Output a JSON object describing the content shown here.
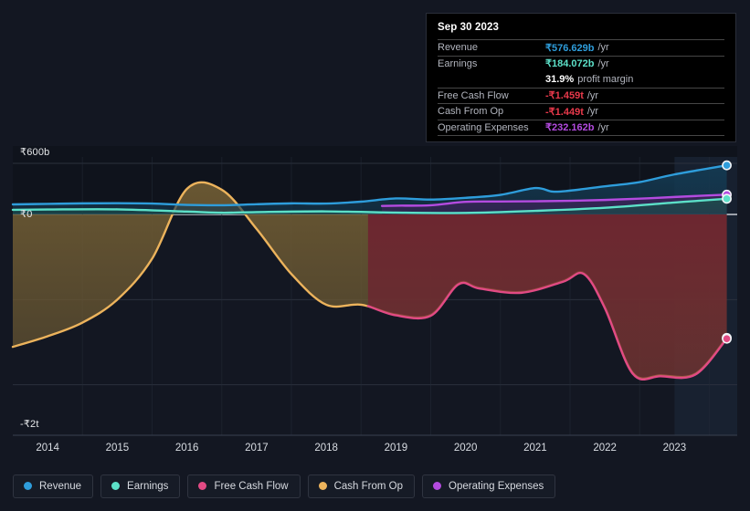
{
  "chart_data": {
    "type": "area",
    "title": "",
    "xlabel": "",
    "ylabel": "",
    "currency": "INR",
    "grid": true,
    "legend_position": "bottom",
    "x_ticks": [
      "2014",
      "2015",
      "2016",
      "2017",
      "2018",
      "2019",
      "2020",
      "2021",
      "2022",
      "2023"
    ],
    "y_ticks": [
      "₹600b",
      "₹0",
      "-₹2t"
    ],
    "y_tick_values": [
      600000000000,
      0,
      -2000000000000
    ],
    "ylim": [
      -2200000000000,
      760000000000
    ],
    "xlim": [
      "2013.5",
      "2023.9"
    ],
    "gridlines_y": [
      600000000000,
      0,
      -1000000000000,
      -2000000000000
    ],
    "series": [
      {
        "name": "Revenue",
        "color": "#2e9ddb",
        "fill": "#143a52",
        "x": [
          2013.5,
          2014,
          2014.5,
          2015,
          2015.5,
          2016,
          2016.5,
          2017,
          2017.5,
          2018,
          2018.5,
          2019,
          2019.5,
          2020,
          2020.5,
          2021,
          2021.25,
          2021.5,
          2022,
          2022.5,
          2023,
          2023.75
        ],
        "values": [
          118000000000,
          124000000000,
          130000000000,
          132000000000,
          128000000000,
          112000000000,
          108000000000,
          120000000000,
          130000000000,
          128000000000,
          150000000000,
          188000000000,
          175000000000,
          195000000000,
          230000000000,
          310000000000,
          268000000000,
          280000000000,
          330000000000,
          380000000000,
          470000000000,
          576629000000
        ]
      },
      {
        "name": "Earnings",
        "color": "#5ce0c8",
        "fill": "#1c4b4a",
        "x": [
          2013.5,
          2014,
          2015,
          2016,
          2016.5,
          2017,
          2018,
          2019,
          2020,
          2021,
          2022,
          2023,
          2023.75
        ],
        "values": [
          54000000000,
          58000000000,
          60000000000,
          34000000000,
          20000000000,
          28000000000,
          36000000000,
          22000000000,
          18000000000,
          42000000000,
          78000000000,
          140000000000,
          184072000000
        ]
      },
      {
        "name": "Free Cash Flow",
        "color": "#e24a84",
        "fill": "#6d2430",
        "x": [
          2018.6,
          2019,
          2019.5,
          2019.9,
          2020.2,
          2020.8,
          2021.4,
          2021.7,
          2022,
          2022.4,
          2022.8,
          2023.3,
          2023.75
        ],
        "values": [
          -1075000000000,
          -1185000000000,
          -1190000000000,
          -820000000000,
          -870000000000,
          -920000000000,
          -790000000000,
          -700000000000,
          -1100000000000,
          -1870000000000,
          -1900000000000,
          -1880000000000,
          -1459000000000
        ]
      },
      {
        "name": "Cash From Op",
        "color": "#ecb35c",
        "fill": "#6d5a33",
        "x": [
          2013.5,
          2014,
          2014.5,
          2015,
          2015.5,
          2016,
          2016.5,
          2017,
          2017.5,
          2018,
          2018.5,
          2019,
          2019.5,
          2019.9,
          2020.2,
          2020.8,
          2021.4,
          2021.7,
          2022,
          2022.4,
          2022.8,
          2023.3,
          2023.75
        ],
        "values": [
          -1555000000000,
          -1430000000000,
          -1270000000000,
          -1000000000000,
          -520000000000,
          300000000000,
          290000000000,
          -170000000000,
          -700000000000,
          -1060000000000,
          -1060000000000,
          -1175000000000,
          -1180000000000,
          -810000000000,
          -860000000000,
          -910000000000,
          -780000000000,
          -690000000000,
          -1090000000000,
          -1860000000000,
          -1890000000000,
          -1870000000000,
          -1449000000000
        ]
      },
      {
        "name": "Operating Expenses",
        "color": "#b44be0",
        "fill": "#3a2458",
        "x": [
          2018.8,
          2019,
          2019.5,
          2020,
          2020.5,
          2021,
          2021.5,
          2022,
          2022.5,
          2023,
          2023.75
        ],
        "values": [
          100000000000,
          103000000000,
          108000000000,
          148000000000,
          152000000000,
          155000000000,
          160000000000,
          170000000000,
          185000000000,
          205000000000,
          232162000000
        ]
      }
    ],
    "endpoints": [
      {
        "series": "Revenue",
        "value": 576629000000,
        "color": "#2e9ddb"
      },
      {
        "series": "Operating Expenses",
        "value": 232162000000,
        "color": "#b44be0"
      },
      {
        "series": "Earnings",
        "value": 184072000000,
        "color": "#5ce0c8"
      },
      {
        "series": "Cash From Op",
        "value": -1449000000000,
        "color": "#ecb35c"
      },
      {
        "series": "Free Cash Flow",
        "value": -1459000000000,
        "color": "#e24a84"
      }
    ],
    "forecast_band_start": "2023.0"
  },
  "tooltip": {
    "date": "Sep 30 2023",
    "rows": [
      {
        "label": "Revenue",
        "value": "₹576.629b",
        "unit": "/yr",
        "color": "#2e9ddb"
      },
      {
        "label": "Earnings",
        "value": "₹184.072b",
        "unit": "/yr",
        "color": "#5ce0c8"
      },
      {
        "label": "",
        "value": "31.9%",
        "unit": "profit margin",
        "color": "#ffffff"
      },
      {
        "label": "Free Cash Flow",
        "value": "-₹1.459t",
        "unit": "/yr",
        "color": "#e8394b"
      },
      {
        "label": "Cash From Op",
        "value": "-₹1.449t",
        "unit": "/yr",
        "color": "#e8394b"
      },
      {
        "label": "Operating Expenses",
        "value": "₹232.162b",
        "unit": "/yr",
        "color": "#b44be0"
      }
    ]
  },
  "legend": {
    "items": [
      {
        "label": "Revenue",
        "color": "#2e9ddb"
      },
      {
        "label": "Earnings",
        "color": "#5ce0c8"
      },
      {
        "label": "Free Cash Flow",
        "color": "#e24a84"
      },
      {
        "label": "Cash From Op",
        "color": "#ecb35c"
      },
      {
        "label": "Operating Expenses",
        "color": "#b44be0"
      }
    ]
  }
}
